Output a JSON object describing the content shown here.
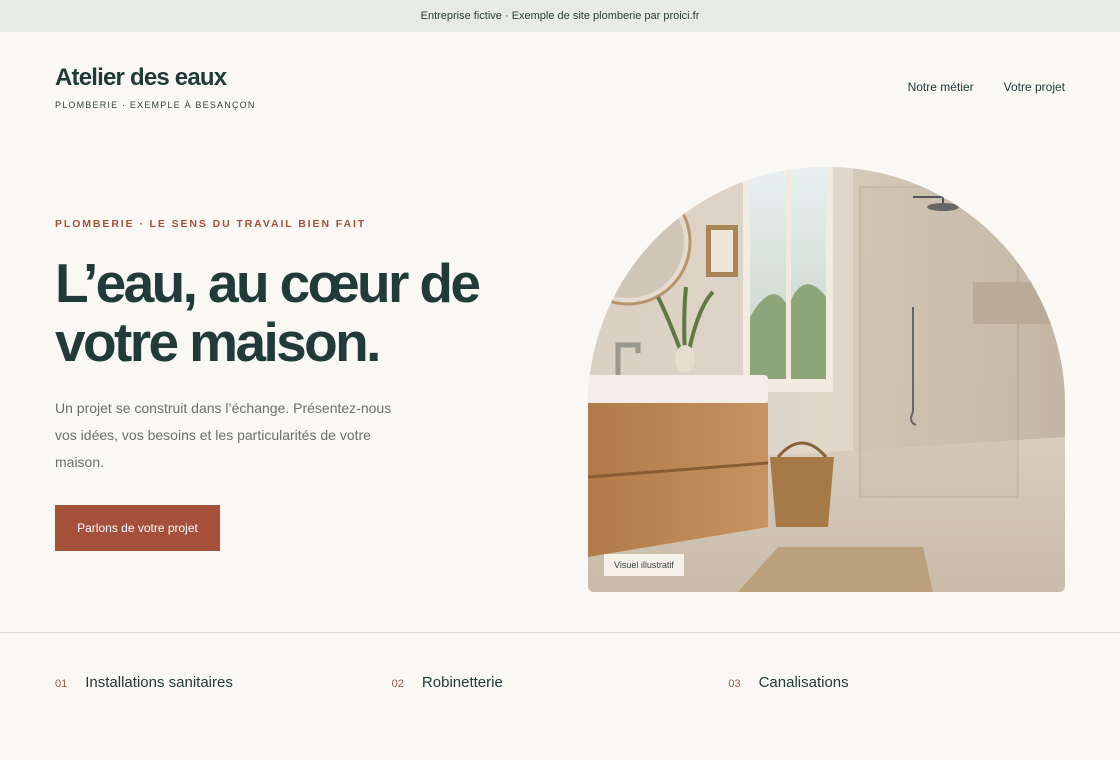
{
  "topbar": {
    "text": "Entreprise fictive · Exemple de site plomberie par proici.fr"
  },
  "brand": {
    "name": "Atelier des eaux",
    "tagline": "PLOMBERIE · EXEMPLE À BESANÇON"
  },
  "nav": {
    "items": [
      {
        "label": "Notre métier"
      },
      {
        "label": "Votre projet"
      }
    ]
  },
  "hero": {
    "eyebrow": "PLOMBERIE · LE SENS DU TRAVAIL BIEN FAIT",
    "headline": "L’eau, au cœur de votre maison.",
    "intro": "Un projet se construit dans l’échange. Présentez-nous vos idées, vos besoins et les particularités de votre maison.",
    "cta_label": "Parlons de votre projet",
    "image_caption": "Visuel illustratif"
  },
  "services": [
    {
      "num": "01",
      "label": "Installations sanitaires"
    },
    {
      "num": "02",
      "label": "Robinetterie"
    },
    {
      "num": "03",
      "label": "Canalisations"
    }
  ],
  "colors": {
    "accent": "#a5503a",
    "dark_green": "#203b38",
    "background": "#faf8f4",
    "topbar": "#e7ebe4"
  }
}
